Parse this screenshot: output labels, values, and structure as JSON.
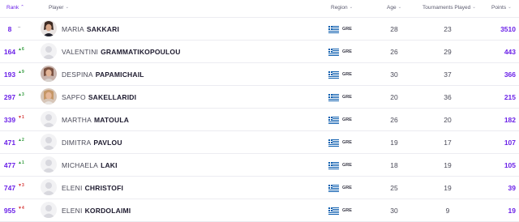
{
  "header": {
    "rank": "Rank",
    "player": "Player",
    "region": "Region",
    "age": "Age",
    "tournaments_played": "Tournaments Played",
    "points": "Points"
  },
  "colors": {
    "accent": "#6b21e8",
    "up": "#2f9a3a",
    "down": "#d63a3a"
  },
  "rows": [
    {
      "rank": "8",
      "movement": "–",
      "first": "MARIA",
      "last": "SAKKARI",
      "country": "GRE",
      "age": "28",
      "tournaments": "23",
      "points": "3510",
      "avatar": "photo"
    },
    {
      "rank": "164",
      "movement": "▲6",
      "first": "VALENTINI",
      "last": "GRAMMATIKOPOULOU",
      "country": "GRE",
      "age": "26",
      "tournaments": "29",
      "points": "443",
      "avatar": "placeholder"
    },
    {
      "rank": "193",
      "movement": "▲9",
      "first": "DESPINA",
      "last": "PAPAMICHAIL",
      "country": "GRE",
      "age": "30",
      "tournaments": "37",
      "points": "366",
      "avatar": "photo"
    },
    {
      "rank": "297",
      "movement": "▲3",
      "first": "SAPFO",
      "last": "SAKELLARIDI",
      "country": "GRE",
      "age": "20",
      "tournaments": "36",
      "points": "215",
      "avatar": "photo"
    },
    {
      "rank": "339",
      "movement": "▼1",
      "first": "MARTHA",
      "last": "MATOULA",
      "country": "GRE",
      "age": "26",
      "tournaments": "20",
      "points": "182",
      "avatar": "placeholder"
    },
    {
      "rank": "471",
      "movement": "▲2",
      "first": "DIMITRA",
      "last": "PAVLOU",
      "country": "GRE",
      "age": "19",
      "tournaments": "17",
      "points": "107",
      "avatar": "placeholder"
    },
    {
      "rank": "477",
      "movement": "▲1",
      "first": "MICHAELA",
      "last": "LAKI",
      "country": "GRE",
      "age": "18",
      "tournaments": "19",
      "points": "105",
      "avatar": "placeholder"
    },
    {
      "rank": "747",
      "movement": "▼3",
      "first": "ELENI",
      "last": "CHRISTOFI",
      "country": "GRE",
      "age": "25",
      "tournaments": "19",
      "points": "39",
      "avatar": "placeholder"
    },
    {
      "rank": "955",
      "movement": "▼4",
      "first": "ELENI",
      "last": "KORDOLAIMI",
      "country": "GRE",
      "age": "30",
      "tournaments": "9",
      "points": "19",
      "avatar": "placeholder"
    }
  ]
}
